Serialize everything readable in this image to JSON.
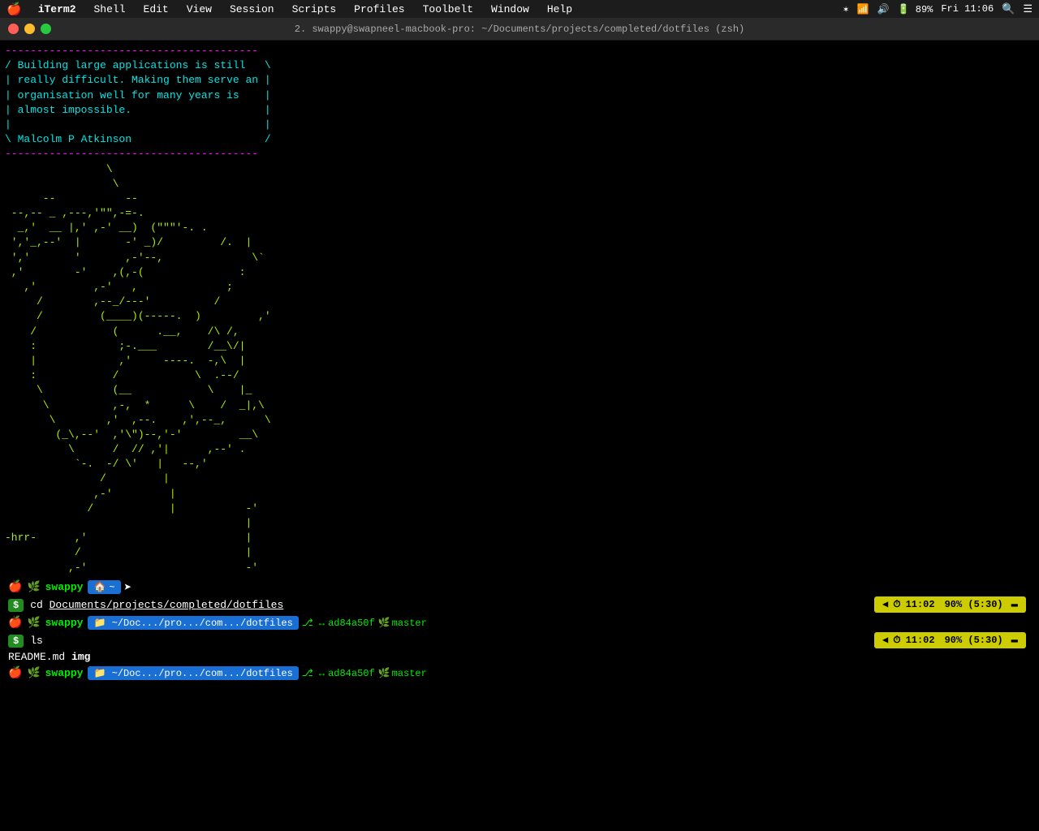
{
  "menubar": {
    "apple": "🍎",
    "items": [
      "iTerm2",
      "Shell",
      "Edit",
      "View",
      "Session",
      "Scripts",
      "Profiles",
      "Toolbelt",
      "Window",
      "Help"
    ],
    "right": {
      "wifi": "wifi",
      "volume": "🔊",
      "battery": "89%",
      "time": "Fri 11:06"
    }
  },
  "titlebar": {
    "title": "2. swappy@swapneel-macbook-pro: ~/Documents/projects/completed/dotfiles (zsh)"
  },
  "terminal": {
    "quote_lines": [
      "/ Building large applications is still   \\",
      "| really difficult. Making them serve an |",
      "| organisation well for many years is    |",
      "| almost impossible.                     |",
      "|                                        |",
      "\\ Malcolm P Atkinson                     /"
    ],
    "ascii_art": "                  \\\n                   \\\n         -- ,---,'\"\",-=.\n   --,-- _ ,---,'_)_  (\"\"\"'-. .\n  _,' __ |,' ,-' __) ,-      /. |\n ','_,--'  |      -' _)/          \\`\n ','       '      ,-'--,           :\n ,'        -'   ,(,-(             :\n   ,'        ,-'  ,           ;\n     /       ,--_/---'        /\n     /        (____)(----- .  )          ,'\n    /          (      .__,    /\\ /,\n    :           ;-.___        /__ \\/|\n    |           ,'      ----.  -,\\ |\n    :          /           \\  .--/\n     \\        (__           \\   |_\n      \\       ,-,  *     \\   /  _|,\\\n       \\     ,'  ,--.   ,',--_,    \\\n        (_\\,-'   ,'\\\")-,'-'        __\\\n          \\    /  //  ,'|     ,--' .\n           `-. -/ \\'  |  --,'\n              /        |\n             ,-'        |\n            /           |          -'\n                                   |\n-hrr-     ,'                       |\n          /                         |\n         ,-'                        -'"
  },
  "prompts": [
    {
      "type": "user_prompt",
      "username": "swappy",
      "home_icon": "🏠",
      "path": "~"
    },
    {
      "type": "cmd_prompt",
      "dollar": "$",
      "command": "cd Documents/projects/completed/dotfiles",
      "underline_start": 3,
      "time_badge": "⏱ 11:02",
      "pct_badge": "90% (5:30)"
    },
    {
      "type": "git_prompt",
      "username": "swappy",
      "path": "~/Doc.../pro.../com.../dotfiles",
      "git_icons": "⎇ ↔",
      "commit": "ad84a50f",
      "branch": "master"
    },
    {
      "type": "cmd_prompt",
      "dollar": "$",
      "command": "ls",
      "time_badge": "⏱ 11:02",
      "pct_badge": "90% (5:30)"
    },
    {
      "type": "output",
      "content": "README.md  img"
    },
    {
      "type": "git_prompt",
      "username": "swappy",
      "path": "~/Doc.../pro.../com.../dotfiles",
      "git_icons": "⎇ ↔",
      "commit": "ad84a50f",
      "branch": "master"
    }
  ],
  "colors": {
    "cyan": "#00e5e5",
    "magenta": "#ff00ff",
    "green": "#00ee00",
    "yellow": "#cccc00",
    "orange": "#ff8800",
    "bg": "#000000",
    "blue_badge": "#1a6fd4",
    "green_badge": "#228b22"
  }
}
